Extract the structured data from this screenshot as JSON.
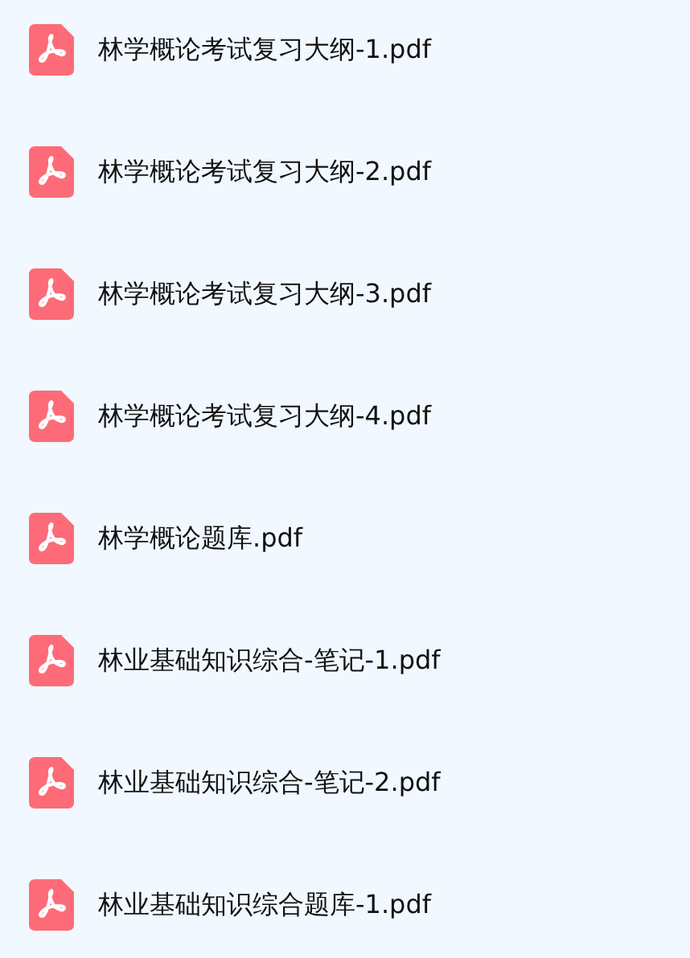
{
  "files": [
    {
      "name": "林学概论考试复习大纲-1.pdf",
      "kind": "pdf"
    },
    {
      "name": "林学概论考试复习大纲-2.pdf",
      "kind": "pdf"
    },
    {
      "name": "林学概论考试复习大纲-3.pdf",
      "kind": "pdf"
    },
    {
      "name": "林学概论考试复习大纲-4.pdf",
      "kind": "pdf"
    },
    {
      "name": "林学概论题库.pdf",
      "kind": "pdf"
    },
    {
      "name": "林业基础知识综合-笔记-1.pdf",
      "kind": "pdf"
    },
    {
      "name": "林业基础知识综合-笔记-2.pdf",
      "kind": "pdf"
    },
    {
      "name": "林业基础知识综合题库-1.pdf",
      "kind": "pdf"
    }
  ]
}
